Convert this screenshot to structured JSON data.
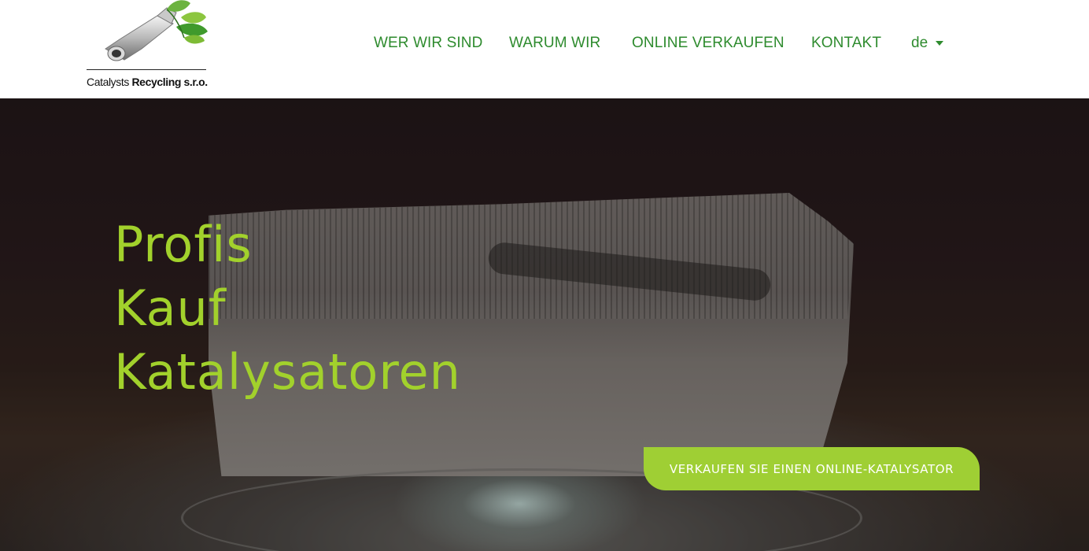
{
  "logo": {
    "text_regular": "Catalysts ",
    "text_bold": "Recycling s.r.o."
  },
  "nav": {
    "items": [
      {
        "label": "WER WIR SIND"
      },
      {
        "label": "WARUM WIR"
      },
      {
        "label": "ONLINE VERKAUFEN"
      },
      {
        "label": "KONTAKT"
      }
    ],
    "language": "de"
  },
  "hero": {
    "title_lines": [
      "Profis",
      "Kauf",
      "Katalysatoren"
    ],
    "cta_label": "VERKAUFEN SIE EINEN ONLINE-KATALYSATOR"
  },
  "colors": {
    "nav_green": "#2e8b2e",
    "accent_lime": "#a2d12c",
    "cta_background": "#9fcf34"
  }
}
